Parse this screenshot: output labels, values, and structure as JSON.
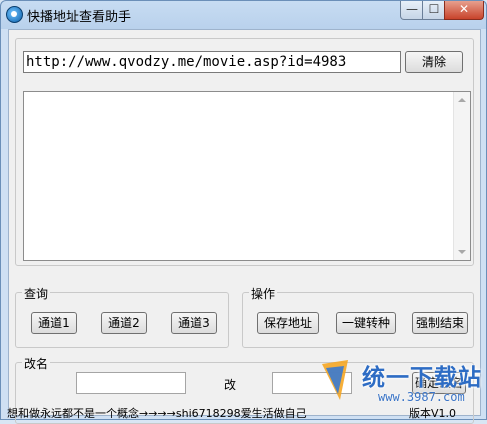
{
  "window": {
    "title": "快播地址查看助手",
    "controls": {
      "minimize": "—",
      "maximize": "☐",
      "close": "✕"
    }
  },
  "url_bar": {
    "value": "http://www.qvodzy.me/movie.asp?id=4983",
    "clear_label": "清除"
  },
  "result_text": "",
  "query_group": {
    "legend": "查询",
    "buttons": [
      "通道1",
      "通道2",
      "通道3"
    ]
  },
  "action_group": {
    "legend": "操作",
    "buttons": [
      "保存地址",
      "一键转种",
      "强制结束"
    ]
  },
  "rename_group": {
    "legend": "改名",
    "from_value": "",
    "change_label": "改",
    "to_value": "",
    "confirm_label": "确定改名"
  },
  "status_bar": {
    "message": "想和做永远都不是一个概念→→→→shi6718298爱生活做自己",
    "version": "版本V1.0"
  },
  "watermark": {
    "name": "统一下载站",
    "url": "www.3987.com",
    "color": "#2d6cc4"
  },
  "icons": {
    "app": "qvod-player-icon"
  }
}
